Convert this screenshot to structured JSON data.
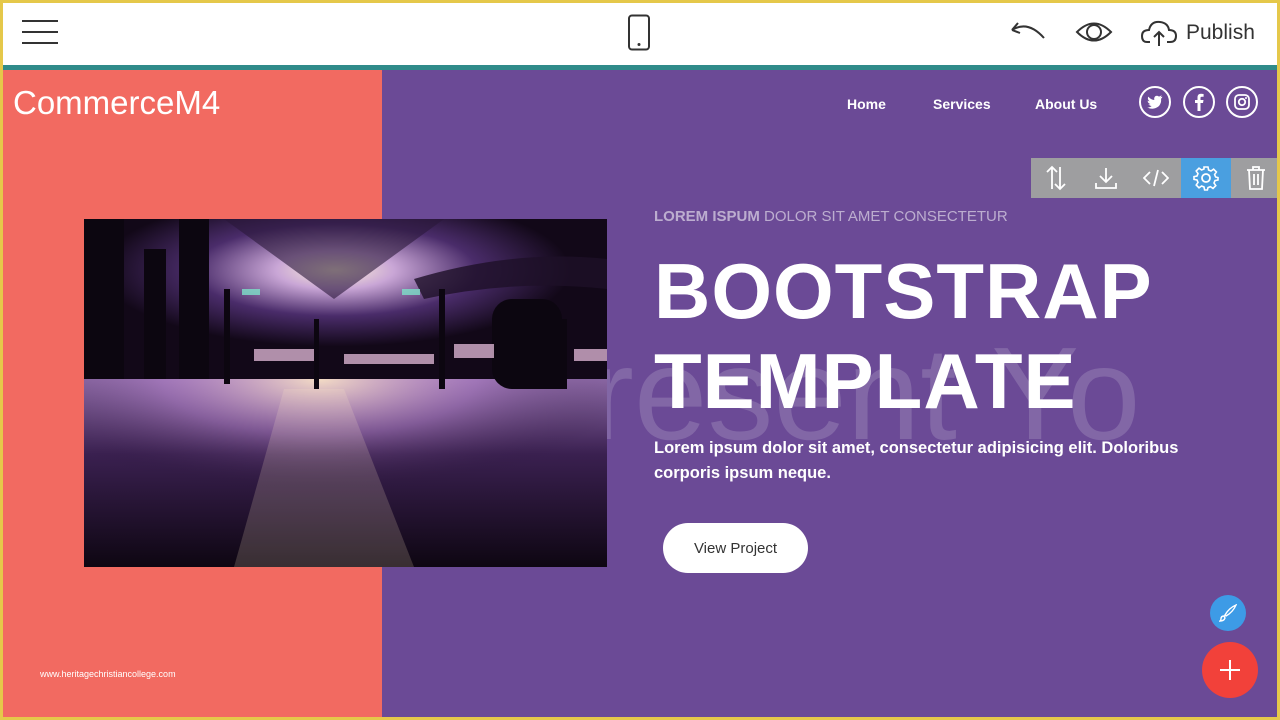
{
  "editor": {
    "menu_icon": "hamburger-menu-icon",
    "device_icon": "mobile-phone-icon",
    "undo_icon": "undo-icon",
    "preview_icon": "eye-icon",
    "publish_icon": "cloud-upload-icon",
    "publish_label": "Publish"
  },
  "site": {
    "brand": "CommerceM4",
    "nav": [
      "Home",
      "Services",
      "About Us"
    ],
    "social": [
      "twitter-icon",
      "facebook-icon",
      "instagram-icon"
    ]
  },
  "block_toolbar": {
    "buttons": [
      "reorder-icon",
      "download-icon",
      "code-icon",
      "gear-icon",
      "trash-icon"
    ],
    "active": "gear-icon"
  },
  "hero": {
    "subtitle_bold": "LOREM ISPUM",
    "subtitle_rest": " DOLOR SIT AMET CONSECTETUR",
    "headline_line1": "BOOTSTRAP",
    "headline_line2": "TEMPLATE",
    "background_text": "resent Yo",
    "body": "Lorem ipsum dolor sit amet, consectetur adipisicing elit. Doloribus corporis ipsum neque.",
    "button_label": "View Project"
  },
  "watermark": "www.heritagechristiancollege.com",
  "colors": {
    "left_panel": "#f26a61",
    "right_panel": "#6b4a96",
    "accent_bar": "#2f8b8a",
    "active_tool": "#4a9fe0",
    "fab_add": "#f2413a",
    "fab_brush": "#3d9be6"
  }
}
